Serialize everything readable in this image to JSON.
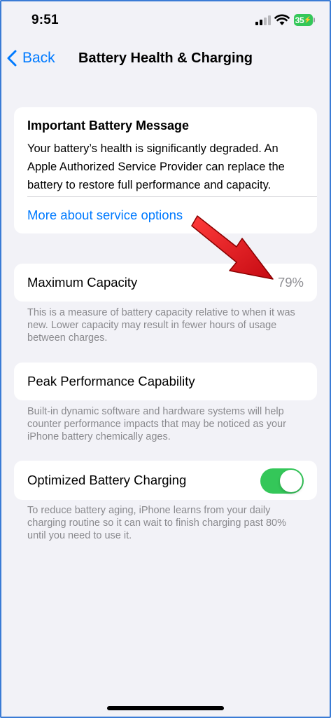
{
  "status_bar": {
    "time": "9:51",
    "battery_level": "35",
    "signal_bars_active": 2,
    "signal_bars_total": 4,
    "battery_color": "#34c759",
    "icons": [
      "cellular-signal-icon",
      "wifi-icon",
      "battery-charging-icon"
    ]
  },
  "nav": {
    "back_label": "Back",
    "title": "Battery Health & Charging",
    "accent_color": "#007aff"
  },
  "message_card": {
    "title": "Important Battery Message",
    "body": "Your battery’s health is significantly degraded. An Apple Authorized Service Provider can replace the battery to restore full performance and capacity.",
    "link": "More about service options"
  },
  "max_capacity": {
    "label": "Maximum Capacity",
    "value": "79%",
    "footer": "This is a measure of battery capacity relative to when it was new. Lower capacity may result in fewer hours of usage between charges."
  },
  "peak_performance": {
    "label": "Peak Performance Capability",
    "footer": "Built-in dynamic software and hardware systems will help counter performance impacts that may be noticed as your iPhone battery chemically ages."
  },
  "optimized_charging": {
    "label": "Optimized Battery Charging",
    "enabled": true,
    "toggle_color": "#34c759",
    "footer": "To reduce battery aging, iPhone learns from your daily charging routine so it can wait to finish charging past 80% until you need to use it."
  },
  "annotation": {
    "arrow_color": "#e8141c",
    "points_to": "max-capacity-value"
  }
}
